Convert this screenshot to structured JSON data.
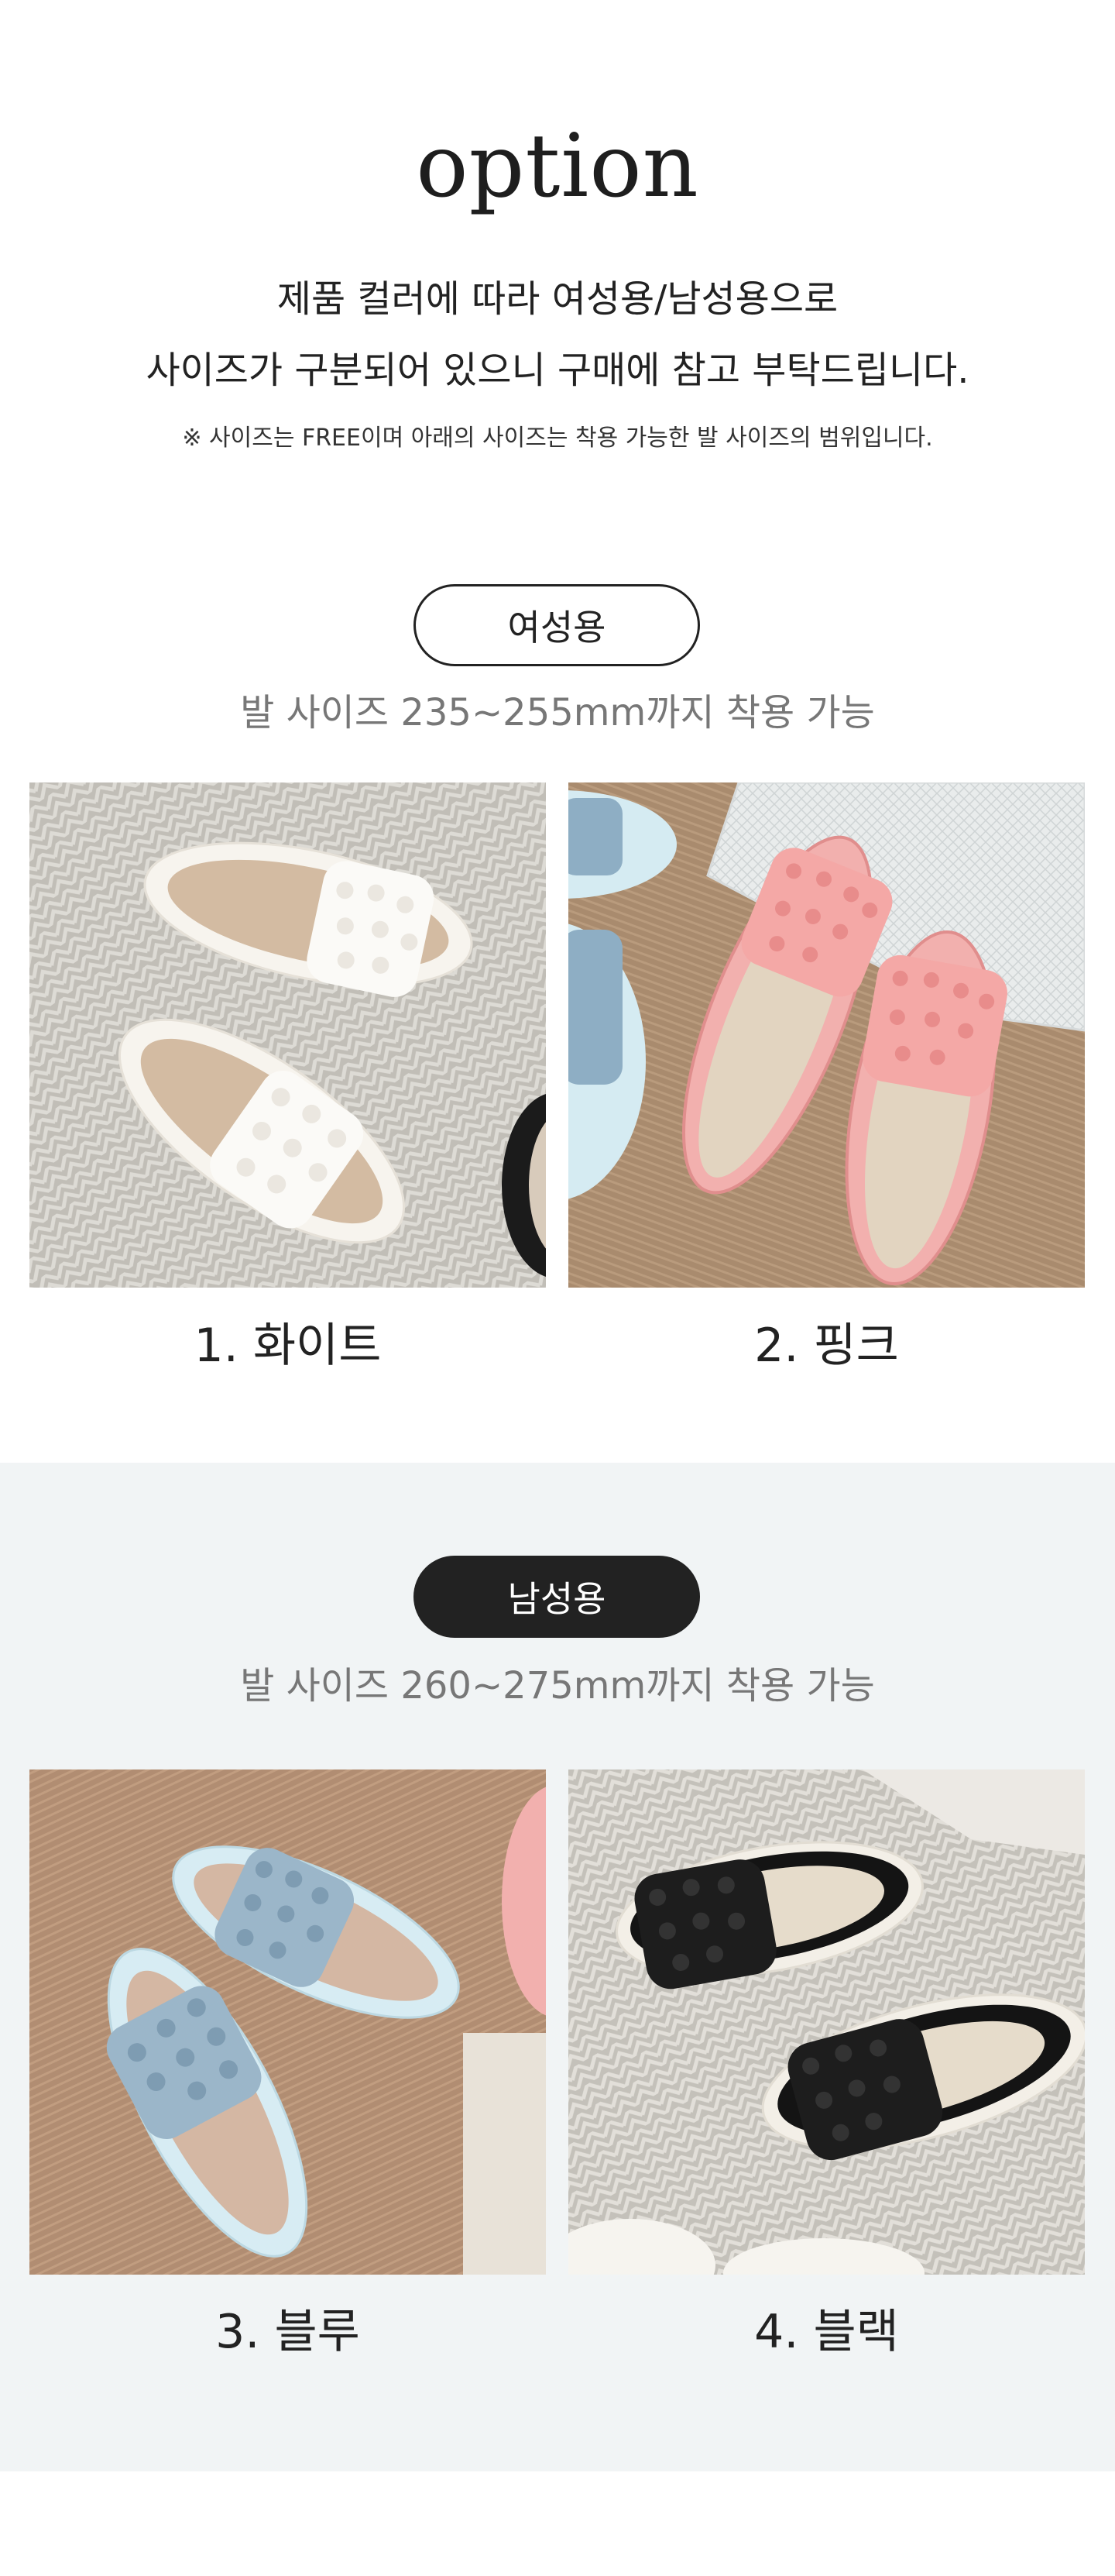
{
  "intro": {
    "title": "option",
    "line1": "제품 컬러에 따라 여성용/남성용으로",
    "line2": "사이즈가 구분되어 있으니 구매에 참고 부탁드립니다.",
    "note": "※ 사이즈는 FREE이며 아래의 사이즈는 착용 가능한 발 사이즈의 범위입니다."
  },
  "women": {
    "badge": "여성용",
    "size_text": "발 사이즈 235~255mm까지 착용 가능",
    "products": [
      {
        "label": "1. 화이트",
        "color": "#f6f3ee"
      },
      {
        "label": "2. 핑크",
        "color": "#f2a8a6"
      }
    ]
  },
  "men": {
    "badge": "남성용",
    "size_text": "발 사이즈 260~275mm까지 착용 가능",
    "products": [
      {
        "label": "3. 블루",
        "color": "#a9c3d6"
      },
      {
        "label": "4. 블랙",
        "color": "#1b1b1b"
      }
    ]
  },
  "colors": {
    "women_section_bg": "#ffffff",
    "men_section_bg": "#f1f4f5",
    "badge_dark": "#222222",
    "muted_text": "#777777"
  }
}
